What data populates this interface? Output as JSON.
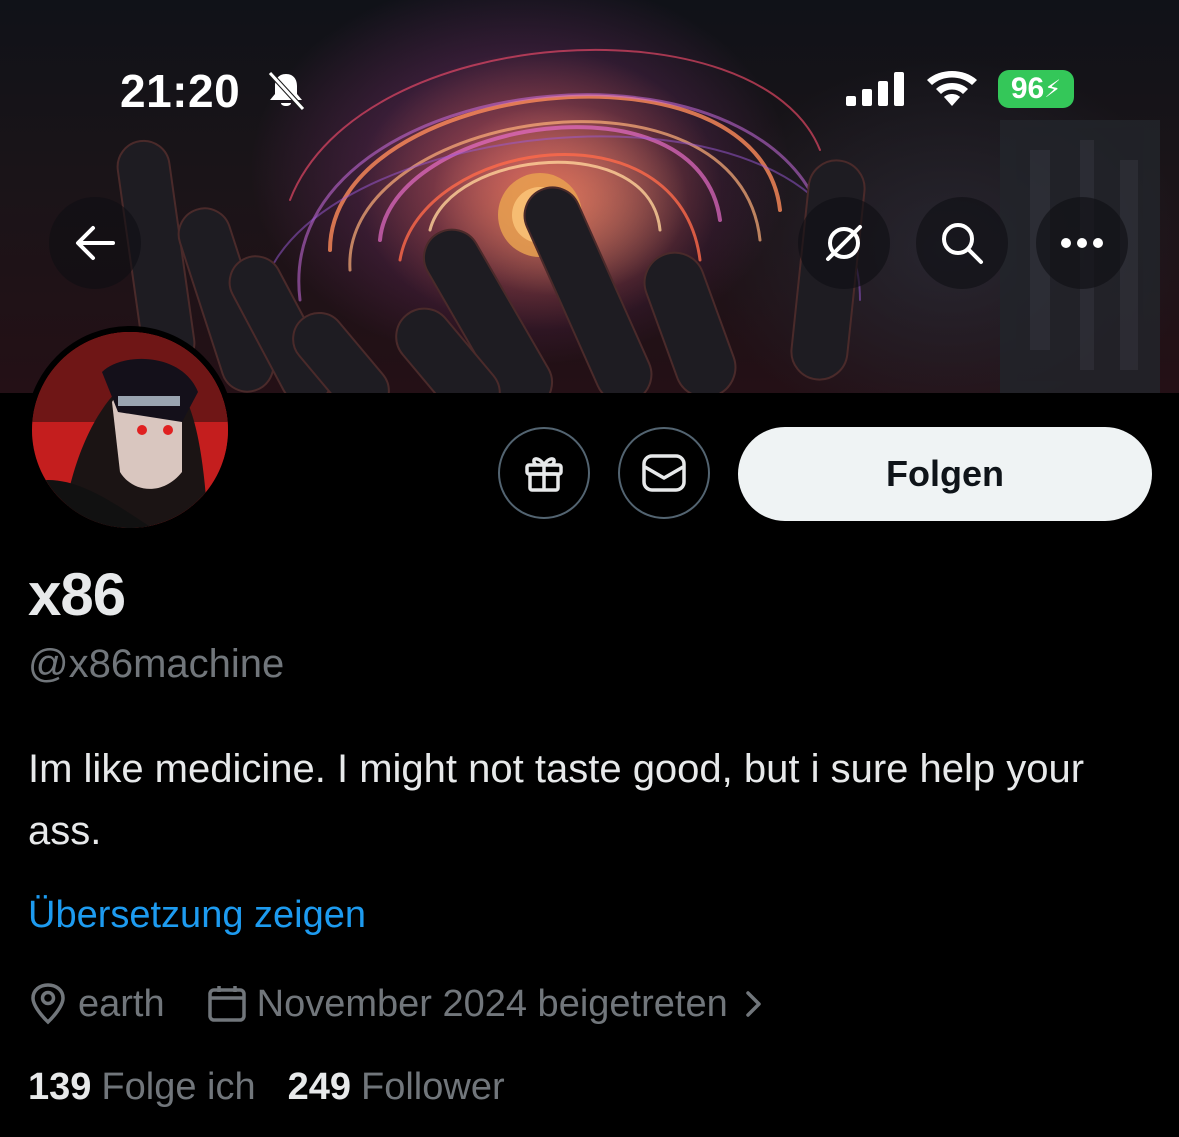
{
  "status_bar": {
    "time": "21:20",
    "battery_level": "96",
    "battery_color": "#34c759",
    "icons": [
      "bell-muted-icon",
      "cellular-signal-icon",
      "wifi-icon",
      "battery-charging-icon"
    ]
  },
  "header": {
    "buttons": [
      "back-arrow-icon",
      "grok-icon",
      "search-icon",
      "more-icon"
    ]
  },
  "profile": {
    "display_name": "x86",
    "handle": "@x86machine",
    "bio": "Im like medicine. I might not taste good, but i sure help your ass.",
    "translate_label": "Übersetzung zeigen",
    "location": "earth",
    "joined": "November 2024 beigetreten",
    "following_count": "139",
    "following_label": "Folge ich",
    "followers_count": "249",
    "followers_label": "Follower"
  },
  "actions": {
    "follow_label": "Folgen",
    "icons": [
      "gift-icon",
      "message-icon"
    ]
  },
  "colors": {
    "background": "#000000",
    "text_primary": "#e7e9ea",
    "text_secondary": "#71767b",
    "link": "#1d9bf0",
    "follow_button_bg": "#eff3f4",
    "border": "#536471"
  }
}
